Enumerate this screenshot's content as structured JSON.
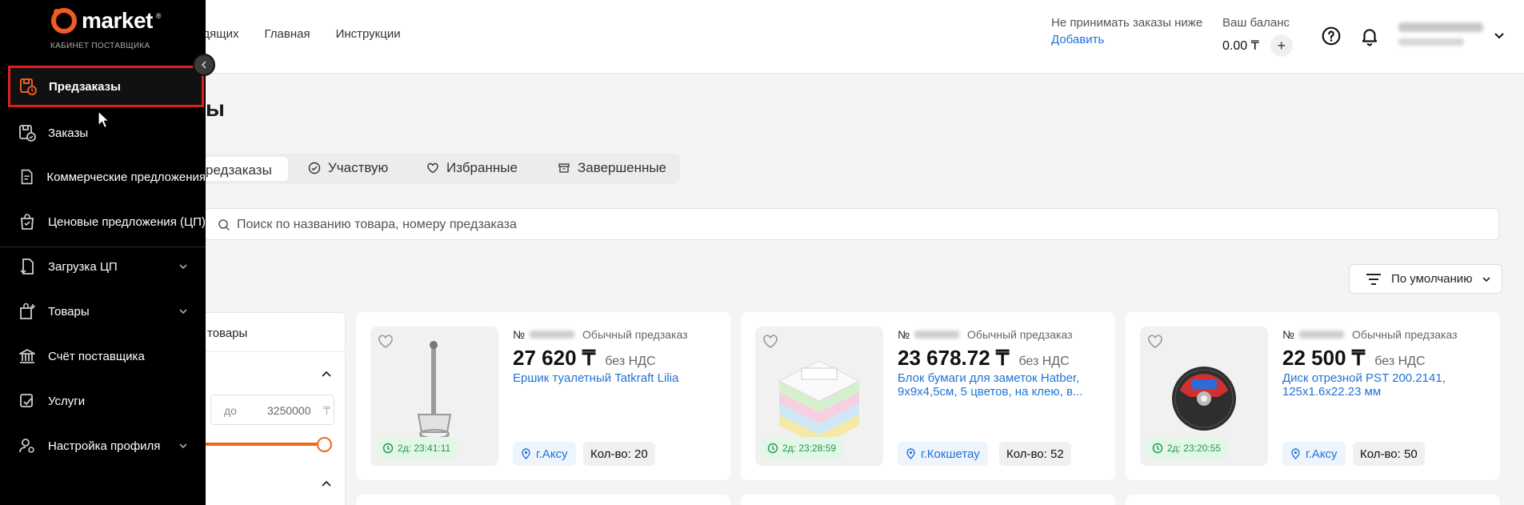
{
  "app": {
    "brand": "market",
    "brand_mark": "®",
    "subtitle": "КАБИНЕТ ПОСТАВЩИКА"
  },
  "sidebar": {
    "items": [
      {
        "label": "Предзаказы",
        "icon": "preorders-icon",
        "active": true
      },
      {
        "label": "Заказы",
        "icon": "orders-icon"
      },
      {
        "label": "Коммерческие предложения",
        "icon": "document-icon"
      },
      {
        "label": "Ценовые предложения (ЦП)",
        "icon": "bag-icon"
      },
      {
        "label": "Загрузка ЦП",
        "icon": "upload-file-icon",
        "expandable": true
      },
      {
        "label": "Товары",
        "icon": "add-product-icon",
        "expandable": true
      },
      {
        "label": "Счёт поставщика",
        "icon": "bank-icon"
      },
      {
        "label": "Услуги",
        "icon": "services-icon"
      },
      {
        "label": "Настройка профиля",
        "icon": "user-settings-icon",
        "expandable": true
      }
    ]
  },
  "header": {
    "nav": [
      "идящих",
      "Главная",
      "Инструкции"
    ],
    "min_order_label": "Не принимать заказы ниже",
    "min_order_action": "Добавить",
    "balance_label": "Ваш баланс",
    "balance_value": "0.00 ₸",
    "balance_add": "+"
  },
  "page": {
    "title": "ы",
    "tabs": [
      {
        "label": "редзаказы",
        "icon": "",
        "active": true
      },
      {
        "label": "Участвую",
        "icon": "check-circle-icon"
      },
      {
        "label": "Избранные",
        "icon": "heart-icon"
      },
      {
        "label": "Завершенные",
        "icon": "archive-icon"
      }
    ],
    "search_placeholder": "Поиск по названию товара, номеру предзаказа",
    "sort_label": "По умолчанию"
  },
  "filter": {
    "title": "товары",
    "range_to_label": "до",
    "range_to_value": "3250000",
    "currency": "₸"
  },
  "cards": [
    {
      "number_prefix": "№",
      "type": "Обычный предзаказ",
      "price": "27 620 ₸",
      "vat": "без НДС",
      "title": "Ершик туалетный Tatkraft Lilia",
      "timer": "2д: 23:41:11",
      "city": "г.Аксу",
      "qty": "Кол-во: 20"
    },
    {
      "number_prefix": "№",
      "type": "Обычный предзаказ",
      "price": "23 678.72 ₸",
      "vat": "без НДС",
      "title": "Блок бумаги для заметок Hatber, 9х9х4,5см, 5 цветов, на клею, в...",
      "timer": "2д: 23:28:59",
      "city": "г.Кокшетау",
      "qty": "Кол-во: 52"
    },
    {
      "number_prefix": "№",
      "type": "Обычный предзаказ",
      "price": "22 500 ₸",
      "vat": "без НДС",
      "title": "Диск отрезной PST 200.2141, 125x1.6x22.23 мм",
      "timer": "2д: 23:20:55",
      "city": "г.Аксу",
      "qty": "Кол-во: 50"
    }
  ],
  "colors": {
    "accent": "#ee6a18",
    "link": "#1f73d6",
    "highlight": "#e01e1e",
    "timer": "#1e9a45"
  }
}
